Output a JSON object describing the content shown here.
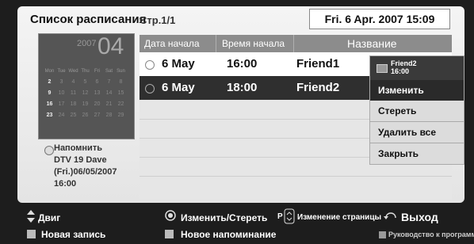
{
  "header": {
    "title": "Список расписания",
    "page": "Стр.1/1",
    "datetime": "Fri. 6 Apr. 2007 15:09"
  },
  "calendar": {
    "year": "2007",
    "month": "04",
    "weekdays": [
      "Mon",
      "Tue",
      "Wed",
      "Thu",
      "Fri",
      "Sat",
      "Sun"
    ],
    "weeks": [
      [
        "",
        "",
        "",
        "",
        "",
        "",
        ""
      ],
      [
        "2",
        "3",
        "4",
        "5",
        "6",
        "7",
        "8"
      ],
      [
        "9",
        "10",
        "11",
        "12",
        "13",
        "14",
        "15"
      ],
      [
        "16",
        "17",
        "18",
        "19",
        "20",
        "21",
        "22"
      ],
      [
        "23",
        "24",
        "25",
        "26",
        "27",
        "28",
        "29"
      ]
    ]
  },
  "reminder": {
    "line1": "Напомнить",
    "line2": "DTV 19 Dave",
    "line3": "(Fri.)06/05/2007",
    "line4": "16:00"
  },
  "table": {
    "columns": [
      "Дата начала",
      "Время начала",
      "Название"
    ],
    "rows": [
      {
        "date": "6 May",
        "time": "16:00",
        "name": "Friend1"
      },
      {
        "date": "6 May",
        "time": "18:00",
        "name": "Friend2"
      }
    ]
  },
  "popup": {
    "item_name": "Friend2",
    "item_time": "16:00",
    "items": [
      "Изменить",
      "Стереть",
      "Удалить все",
      "Закрыть"
    ]
  },
  "footer": {
    "move": "Двиг",
    "edit_delete": "Изменить/Стереть",
    "p_label": "P",
    "page_change": "Изменение страницы",
    "exit": "Выход",
    "new_record": "Новая запись",
    "new_reminder": "Новое напоминание",
    "guide": "Руководство к программ"
  }
}
